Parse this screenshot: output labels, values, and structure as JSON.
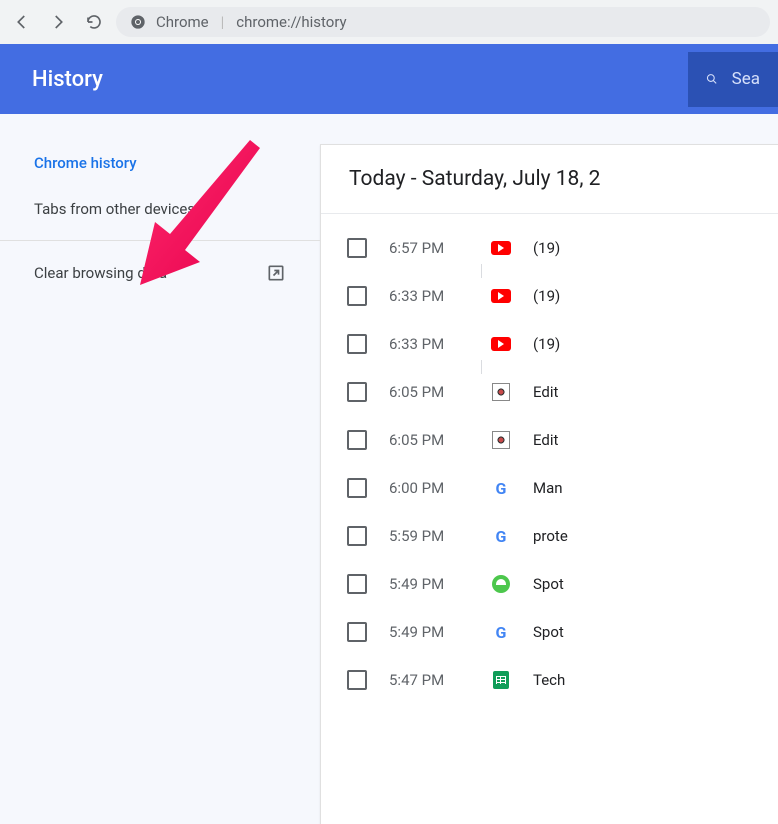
{
  "browser": {
    "app_label": "Chrome",
    "url": "chrome://history"
  },
  "header": {
    "title": "History",
    "search_placeholder": "Sea"
  },
  "sidebar": {
    "items": [
      {
        "label": "Chrome history",
        "active": true,
        "external": false
      },
      {
        "label": "Tabs from other devices",
        "active": false,
        "external": false
      },
      {
        "label": "Clear browsing data",
        "active": false,
        "external": true
      }
    ]
  },
  "history": {
    "date_header": "Today - Saturday, July 18, 2",
    "entries": [
      {
        "time": "6:57 PM",
        "icon": "youtube",
        "title": "(19)",
        "sep": true
      },
      {
        "time": "6:33 PM",
        "icon": "youtube",
        "title": "(19)",
        "sep": false
      },
      {
        "time": "6:33 PM",
        "icon": "youtube",
        "title": "(19)",
        "sep": true
      },
      {
        "time": "6:05 PM",
        "icon": "bot",
        "title": "Edit",
        "sep": false
      },
      {
        "time": "6:05 PM",
        "icon": "bot",
        "title": "Edit",
        "sep": false
      },
      {
        "time": "6:00 PM",
        "icon": "google",
        "title": "Man",
        "sep": false
      },
      {
        "time": "5:59 PM",
        "icon": "google",
        "title": "prote",
        "sep": false
      },
      {
        "time": "5:49 PM",
        "icon": "generic",
        "title": "Spot",
        "sep": false
      },
      {
        "time": "5:49 PM",
        "icon": "google",
        "title": "Spot",
        "sep": false
      },
      {
        "time": "5:47 PM",
        "icon": "sheets",
        "title": "Tech",
        "sep": false
      }
    ]
  },
  "annotation": {
    "arrow_points_to": "clear-browsing-data"
  }
}
